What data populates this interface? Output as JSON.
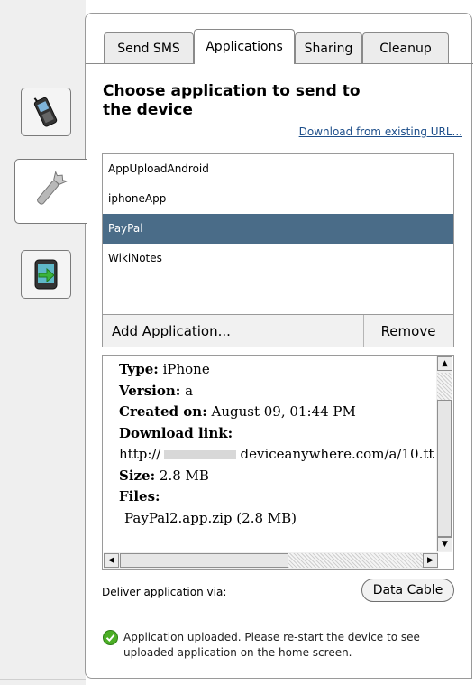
{
  "sidebar": {
    "items": [
      {
        "name": "device-phone"
      },
      {
        "name": "tools"
      },
      {
        "name": "install-app"
      }
    ]
  },
  "tabs": [
    {
      "label": "Send SMS"
    },
    {
      "label": "Applications"
    },
    {
      "label": "Sharing"
    },
    {
      "label": "Cleanup"
    }
  ],
  "main": {
    "title": "Choose application to send to the device",
    "download_link": "Download from existing URL...",
    "apps": [
      "AppUploadAndroid",
      "iphoneApp",
      "PayPal",
      "WikiNotes"
    ],
    "add_label": "Add Application...",
    "remove_label": "Remove"
  },
  "details": {
    "type_label": "Type:",
    "type_value": "iPhone",
    "version_label": "Version:",
    "version_value": "a",
    "created_label": "Created on:",
    "created_value": "August 09, 01:44 PM",
    "download_label": "Download link:",
    "link_prefix": "http://",
    "link_suffix": "deviceanywhere.com/a/10.tt",
    "size_label": "Size:",
    "size_value": "2.8 MB",
    "files_label": "Files:",
    "file_item": "PayPal2.app.zip (2.8 MB)"
  },
  "deliver": {
    "label": "Deliver application via:",
    "button": "Data Cable"
  },
  "status": {
    "message": "Application uploaded. Please re-start the device to see uploaded application on the home screen."
  },
  "colors": {
    "selected_row": "#4a6c88",
    "link": "#1d4e8a",
    "success": "#4caf26"
  }
}
